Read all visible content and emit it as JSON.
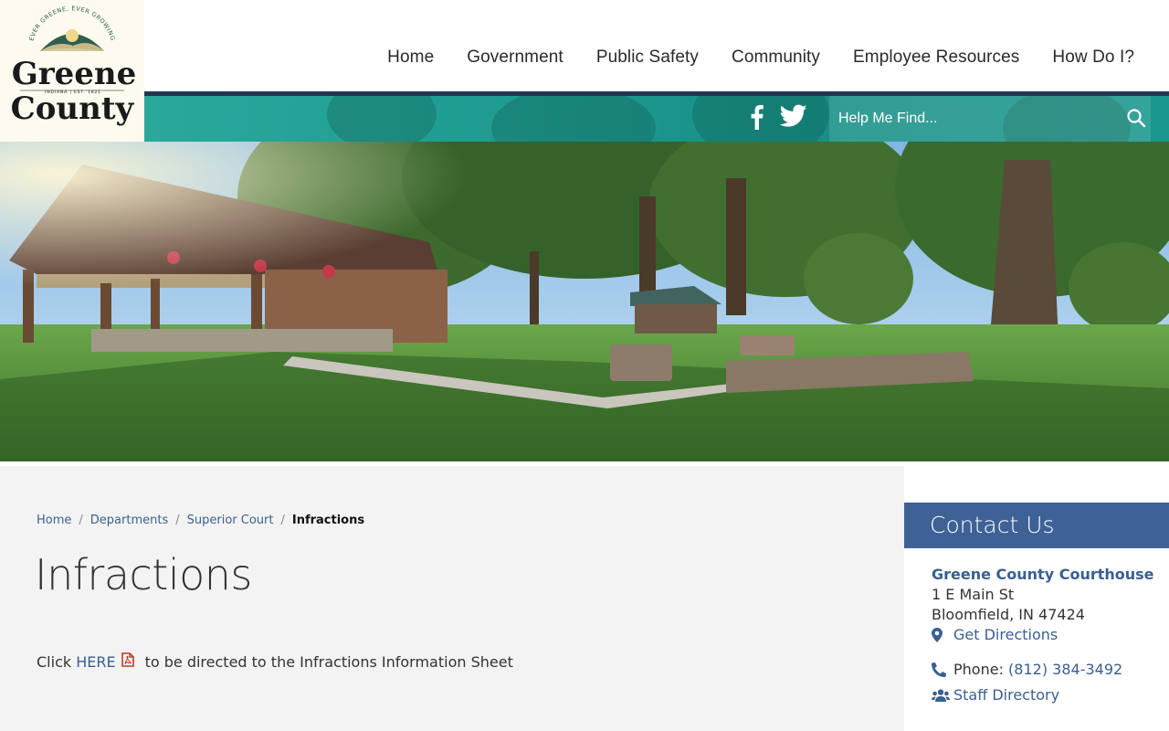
{
  "header": {
    "logo": {
      "tagline": "EVER GREENE, EVER GROWING",
      "name_line1": "Greene",
      "name_line2": "County",
      "sub": "INDIANA | EST. 1821"
    },
    "nav": [
      {
        "label": "Home"
      },
      {
        "label": "Government"
      },
      {
        "label": "Public Safety"
      },
      {
        "label": "Community"
      },
      {
        "label": "Employee Resources"
      },
      {
        "label": "How Do I?"
      }
    ],
    "social": {
      "facebook_icon": "facebook-icon",
      "twitter_icon": "twitter-icon"
    },
    "search": {
      "placeholder": "Help Me Find...",
      "icon": "search-icon"
    }
  },
  "breadcrumb": {
    "items": [
      "Home",
      "Departments",
      "Superior Court"
    ],
    "current": "Infractions",
    "separator": "/"
  },
  "main": {
    "title": "Infractions",
    "body_prefix": "Click",
    "link_text": "HERE",
    "body_suffix": "to be directed to the Infractions Information Sheet",
    "link_icon": "pdf-icon"
  },
  "sidebar": {
    "heading": "Contact Us",
    "org": "Greene County Courthouse",
    "address1": "1 E Main St",
    "address2": "Bloomfield, IN 47424",
    "directions": "Get Directions",
    "phone_label": "Phone:",
    "phone": "(812) 384-3492",
    "staff": "Staff Directory"
  },
  "colors": {
    "nav_rule": "#22364f",
    "teal": "#1f9c91",
    "link": "#3a5f91",
    "contact_head": "#3e6196",
    "content_bg": "#f3f3f3"
  }
}
